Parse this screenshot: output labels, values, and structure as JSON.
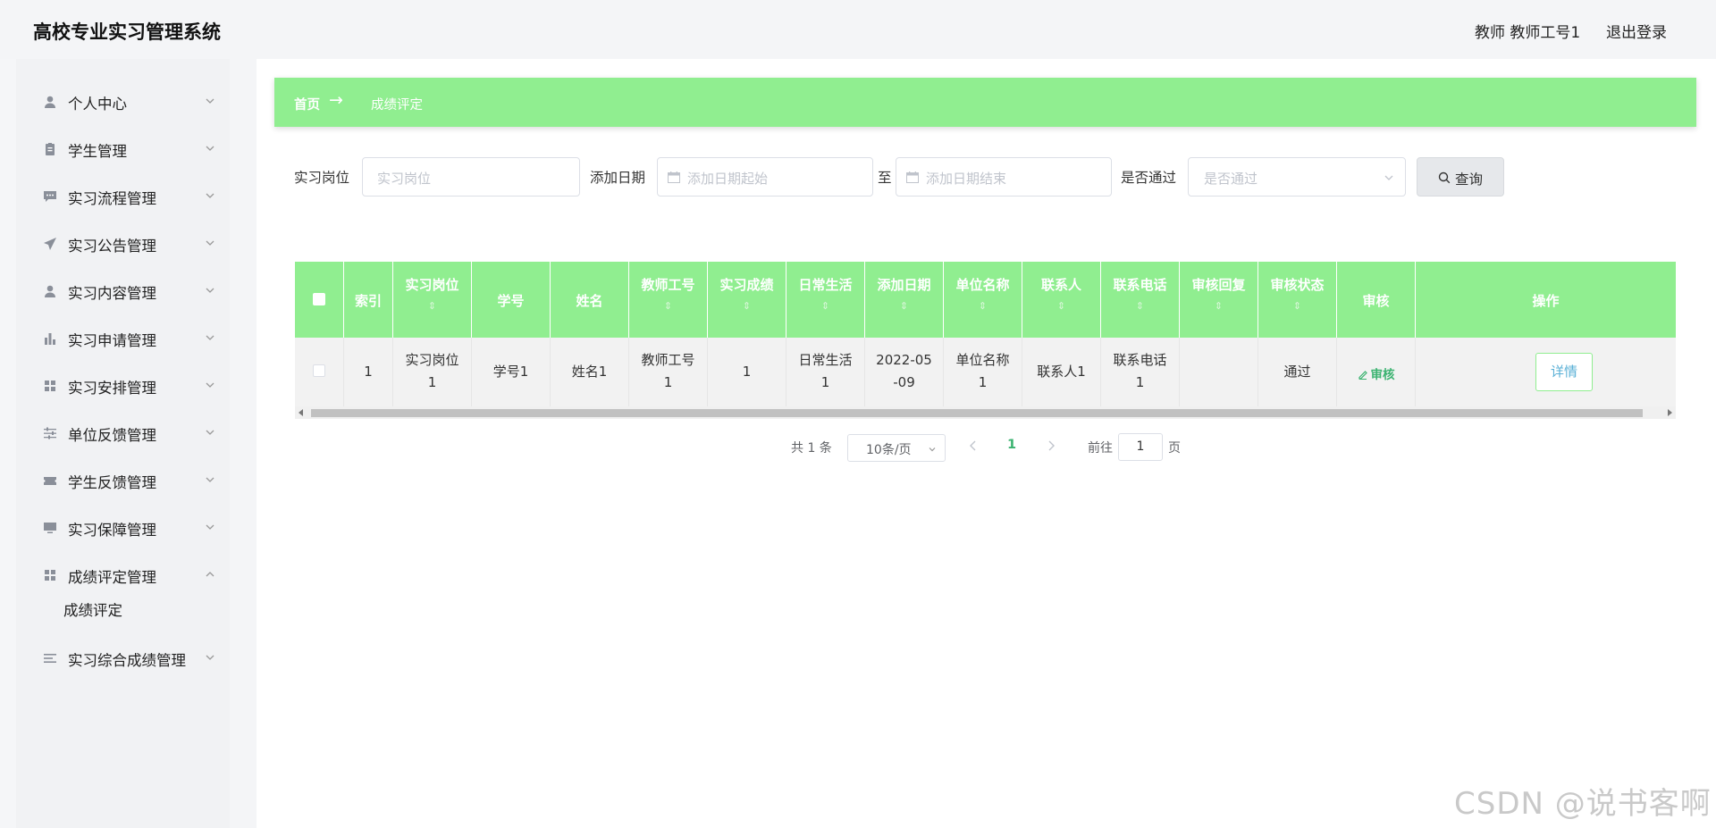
{
  "app": {
    "title": "高校专业实习管理系统"
  },
  "header": {
    "user": "教师 教师工号1",
    "logout": "退出登录"
  },
  "sidebar": {
    "items": [
      {
        "label": "个人中心",
        "icon": "user-icon"
      },
      {
        "label": "学生管理",
        "icon": "clipboard-icon"
      },
      {
        "label": "实习流程管理",
        "icon": "chat-icon"
      },
      {
        "label": "实习公告管理",
        "icon": "send-icon"
      },
      {
        "label": "实习内容管理",
        "icon": "user-icon"
      },
      {
        "label": "实习申请管理",
        "icon": "bar-chart-icon"
      },
      {
        "label": "实习安排管理",
        "icon": "grid-icon"
      },
      {
        "label": "单位反馈管理",
        "icon": "sliders-icon"
      },
      {
        "label": "学生反馈管理",
        "icon": "ticket-icon"
      },
      {
        "label": "实习保障管理",
        "icon": "monitor-icon"
      },
      {
        "label": "成绩评定管理",
        "icon": "grid-icon"
      },
      {
        "label": "实习综合成绩管理",
        "icon": "list-icon"
      }
    ],
    "subitem": "成绩评定"
  },
  "breadcrumb": {
    "home": "首页",
    "arrow": "→",
    "current": "成绩评定"
  },
  "filters": {
    "post_label": "实习岗位",
    "post_placeholder": "实习岗位",
    "date_label": "添加日期",
    "date_start_placeholder": "添加日期起始",
    "to": "至",
    "date_end_placeholder": "添加日期结束",
    "pass_label": "是否通过",
    "pass_placeholder": "是否通过",
    "query_button": "查询"
  },
  "table": {
    "headers": [
      "索引",
      "实习岗位",
      "学号",
      "姓名",
      "教师工号",
      "实习成绩",
      "日常生活",
      "添加日期",
      "单位名称",
      "联系人",
      "联系电话",
      "审核回复",
      "审核状态",
      "审核",
      "操作"
    ],
    "sort_glyph": "⇕",
    "row": {
      "index": "1",
      "post_a": "实习岗位",
      "post_b": "1",
      "student_no": "学号1",
      "name": "姓名1",
      "teacher_a": "教师工号",
      "teacher_b": "1",
      "score": "1",
      "daily_a": "日常生活",
      "daily_b": "1",
      "date_a": "2022-05",
      "date_b": "-09",
      "unit_a": "单位名称",
      "unit_b": "1",
      "contact": "联系人1",
      "phone_a": "联系电话",
      "phone_b": "1",
      "reply": "",
      "status": "通过",
      "audit": "审核",
      "detail": "详情"
    }
  },
  "pagination": {
    "total": "共 1 条",
    "page_size": "10条/页",
    "current": "1",
    "goto": "前往",
    "goto_value": "1",
    "page_unit": "页"
  },
  "watermark": "CSDN @说书客啊",
  "colors": {
    "accent": "#90ee90",
    "active": "#3cb371",
    "detail_text": "#5ab0d6"
  }
}
